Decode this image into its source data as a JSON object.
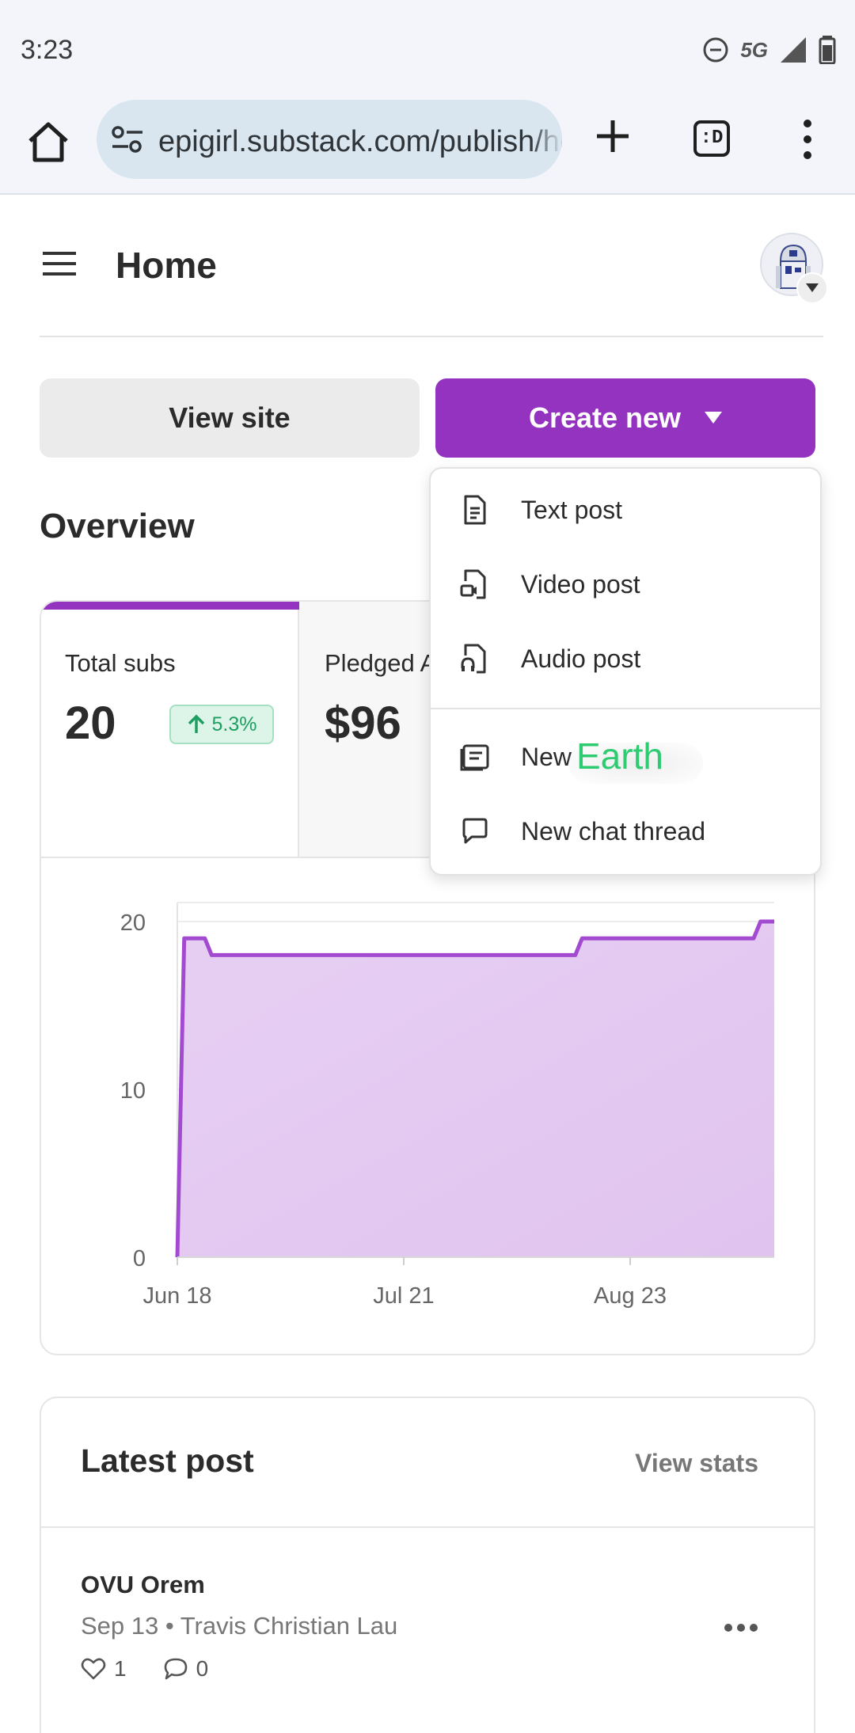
{
  "status_bar": {
    "time": "3:23",
    "network": "5G",
    "icons": [
      "do-not-disturb-icon",
      "signal-icon",
      "battery-icon"
    ]
  },
  "browser": {
    "url": "epigirl.substack.com/publish/home",
    "tab_switcher_label": ":D",
    "icons": [
      "home-icon",
      "site-settings-icon",
      "new-tab-icon",
      "overflow-menu-icon"
    ]
  },
  "header": {
    "title": "Home",
    "icons": [
      "menu-icon",
      "avatar",
      "chevron-down-icon"
    ]
  },
  "actions": {
    "view_site": "View site",
    "create_new": "Create new"
  },
  "overview": {
    "title": "Overview",
    "stats": [
      {
        "label": "Total subs",
        "value": "20",
        "change": "5.3%",
        "selected": true
      },
      {
        "label": "Pledged ARR",
        "value": "$96",
        "selected": false
      }
    ]
  },
  "create_menu": {
    "items": [
      {
        "label": "Text post",
        "icon": "document-icon"
      },
      {
        "label": "Video post",
        "icon": "video-file-icon"
      },
      {
        "label": "Audio post",
        "icon": "audio-file-icon"
      },
      {
        "label": "New",
        "icon": "thread-icon"
      },
      {
        "label": "New chat thread",
        "icon": "chat-bubble-icon"
      }
    ],
    "overlay_text": "Earth"
  },
  "chart_data": {
    "type": "area",
    "x": [
      "Jun 18",
      "Jun 19",
      "Jun 22",
      "Jun 23",
      "Aug 15",
      "Aug 16",
      "Sep 10",
      "Sep 11",
      "Sep 13"
    ],
    "series": [
      {
        "values": [
          0,
          19,
          19,
          18,
          18,
          19,
          19,
          20,
          20
        ]
      }
    ],
    "x_ticks": [
      "Jun 18",
      "Jul 21",
      "Aug 23"
    ],
    "y_ticks": [
      0,
      10,
      20
    ],
    "ylim": [
      0,
      20
    ],
    "grid": true,
    "colors": {
      "line": "#a24bd1",
      "fill": "#e4c9f1"
    }
  },
  "latest_post": {
    "title": "Latest post",
    "view_stats": "View stats",
    "post": {
      "title": "OVU Orem",
      "meta": "Sep 13 • Travis Christian Lau",
      "likes": "1",
      "comments": "0"
    }
  },
  "colors": {
    "accent": "#9333c0",
    "positive": "#1f9e61"
  }
}
